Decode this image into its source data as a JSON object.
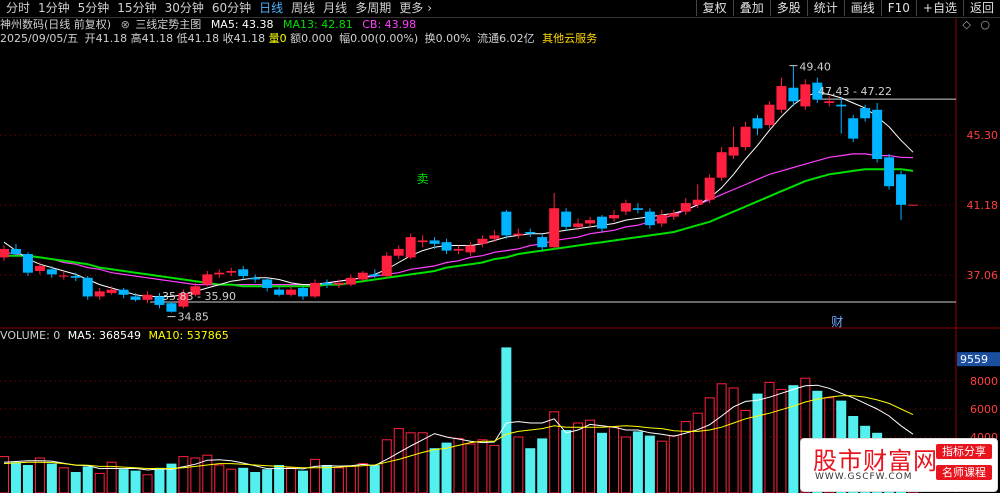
{
  "tabs": [
    {
      "label": "分时",
      "active": false
    },
    {
      "label": "1分钟",
      "active": false
    },
    {
      "label": "5分钟",
      "active": false
    },
    {
      "label": "15分钟",
      "active": false
    },
    {
      "label": "30分钟",
      "active": false
    },
    {
      "label": "60分钟",
      "active": false
    },
    {
      "label": "日线",
      "active": true
    },
    {
      "label": "周线",
      "active": false
    },
    {
      "label": "月线",
      "active": false
    },
    {
      "label": "多周期",
      "active": false
    },
    {
      "label": "更多",
      "active": false
    }
  ],
  "more_arrow": "›",
  "tools": [
    "复权",
    "叠加",
    "多股",
    "统计",
    "画线",
    "F10",
    "+自选",
    "返回"
  ],
  "legend": {
    "title": "神州数码(日线 前复权)",
    "indicator_marker": "⊗",
    "indicator_name": "三线定势主图",
    "ma5": "MA5: 43.38",
    "ma13": "MA13: 42.81",
    "cb": "CB: 43.98",
    "color_ma5": "#ffffff",
    "color_ma13": "#00e000",
    "color_cb": "#ff40ff"
  },
  "corner_icons": [
    "◇",
    "○"
  ],
  "info": {
    "date": "2025/09/05/五",
    "open": "开41.18",
    "high": "高41.18",
    "low": "低41.18",
    "close": "收41.18",
    "vol": "量0",
    "amount": "额0.000",
    "change": "幅0.00(0.00%)",
    "turnover": "换0.00%",
    "float": "流通6.02亿",
    "cloud": "其他云服务"
  },
  "volume_legend": {
    "vol": "VOLUME: 0",
    "ma5": "MA5: 368549",
    "ma10": "MA10: 537865"
  },
  "watermark": {
    "cn": "股市财富网",
    "url": "WWW.GSCFW.COM",
    "tag1": "指标分享",
    "tag2": "名师课程"
  },
  "chart_data": {
    "type": "candlestick",
    "price_axis": {
      "range": [
        34.0,
        50.5
      ],
      "ticks": [
        45.3,
        41.18,
        37.06
      ]
    },
    "volume_axis": {
      "range": [
        0,
        10500
      ],
      "ticks": [
        9559,
        8000,
        6000,
        4000
      ]
    },
    "annotations": {
      "high": "49.40",
      "high_range": "47.43 - 47.22",
      "low": "34.85",
      "low_range": "35.83 - 35.90",
      "sell_mark": "卖",
      "fin_mark": "财"
    },
    "reference_levels": [
      47.43,
      35.83
    ],
    "candles": [
      {
        "o": 38.1,
        "c": 38.6,
        "h": 38.8,
        "l": 37.9
      },
      {
        "o": 38.6,
        "c": 38.3,
        "h": 38.9,
        "l": 38.2
      },
      {
        "o": 38.3,
        "c": 37.2,
        "h": 38.4,
        "l": 37.0
      },
      {
        "o": 37.3,
        "c": 37.6,
        "h": 37.8,
        "l": 37.1
      },
      {
        "o": 37.4,
        "c": 37.1,
        "h": 37.6,
        "l": 36.9
      },
      {
        "o": 37.0,
        "c": 37.0,
        "h": 37.3,
        "l": 36.8
      },
      {
        "o": 37.0,
        "c": 36.9,
        "h": 37.2,
        "l": 36.7
      },
      {
        "o": 36.9,
        "c": 35.8,
        "h": 37.0,
        "l": 35.6
      },
      {
        "o": 35.8,
        "c": 36.1,
        "h": 36.3,
        "l": 35.6
      },
      {
        "o": 36.0,
        "c": 36.2,
        "h": 36.4,
        "l": 35.9
      },
      {
        "o": 36.2,
        "c": 35.9,
        "h": 36.3,
        "l": 35.7
      },
      {
        "o": 35.8,
        "c": 35.6,
        "h": 36.0,
        "l": 35.5
      },
      {
        "o": 35.6,
        "c": 35.9,
        "h": 36.1,
        "l": 35.4
      },
      {
        "o": 35.8,
        "c": 35.3,
        "h": 36.0,
        "l": 35.1
      },
      {
        "o": 35.4,
        "c": 34.9,
        "h": 35.5,
        "l": 34.85
      },
      {
        "o": 35.2,
        "c": 36.0,
        "h": 36.2,
        "l": 35.1
      },
      {
        "o": 35.9,
        "c": 36.4,
        "h": 36.6,
        "l": 35.8
      },
      {
        "o": 36.5,
        "c": 37.1,
        "h": 37.3,
        "l": 36.4
      },
      {
        "o": 37.1,
        "c": 37.2,
        "h": 37.4,
        "l": 36.9
      },
      {
        "o": 37.2,
        "c": 37.3,
        "h": 37.5,
        "l": 37.0
      },
      {
        "o": 37.4,
        "c": 37.0,
        "h": 37.6,
        "l": 36.8
      },
      {
        "o": 36.9,
        "c": 36.8,
        "h": 37.1,
        "l": 36.6
      },
      {
        "o": 36.8,
        "c": 36.3,
        "h": 36.9,
        "l": 36.1
      },
      {
        "o": 36.2,
        "c": 35.9,
        "h": 36.4,
        "l": 35.8
      },
      {
        "o": 35.9,
        "c": 36.2,
        "h": 36.4,
        "l": 35.8
      },
      {
        "o": 36.3,
        "c": 35.8,
        "h": 36.4,
        "l": 35.6
      },
      {
        "o": 35.8,
        "c": 36.6,
        "h": 36.8,
        "l": 35.7
      },
      {
        "o": 36.6,
        "c": 36.5,
        "h": 36.8,
        "l": 36.3
      },
      {
        "o": 36.5,
        "c": 36.6,
        "h": 36.8,
        "l": 36.3
      },
      {
        "o": 36.5,
        "c": 36.9,
        "h": 37.1,
        "l": 36.4
      },
      {
        "o": 36.8,
        "c": 37.2,
        "h": 37.3,
        "l": 36.7
      },
      {
        "o": 37.1,
        "c": 37.0,
        "h": 37.4,
        "l": 36.9
      },
      {
        "o": 37.0,
        "c": 38.2,
        "h": 38.4,
        "l": 36.9
      },
      {
        "o": 38.2,
        "c": 38.6,
        "h": 38.8,
        "l": 38.0
      },
      {
        "o": 38.1,
        "c": 39.3,
        "h": 39.5,
        "l": 38.0
      },
      {
        "o": 39.0,
        "c": 39.1,
        "h": 39.4,
        "l": 38.7
      },
      {
        "o": 39.1,
        "c": 38.9,
        "h": 39.3,
        "l": 38.6
      },
      {
        "o": 39.0,
        "c": 38.5,
        "h": 39.2,
        "l": 38.3
      },
      {
        "o": 38.5,
        "c": 38.6,
        "h": 38.8,
        "l": 38.3
      },
      {
        "o": 38.4,
        "c": 38.8,
        "h": 39.0,
        "l": 38.2
      },
      {
        "o": 38.9,
        "c": 39.2,
        "h": 39.4,
        "l": 38.7
      },
      {
        "o": 39.2,
        "c": 39.4,
        "h": 39.7,
        "l": 39.0
      },
      {
        "o": 40.8,
        "c": 39.4,
        "h": 40.9,
        "l": 39.2
      },
      {
        "o": 39.4,
        "c": 39.5,
        "h": 39.8,
        "l": 39.2
      },
      {
        "o": 39.6,
        "c": 39.5,
        "h": 39.8,
        "l": 39.3
      },
      {
        "o": 39.3,
        "c": 38.7,
        "h": 39.5,
        "l": 38.5
      },
      {
        "o": 38.7,
        "c": 41.0,
        "h": 41.9,
        "l": 38.6
      },
      {
        "o": 40.8,
        "c": 39.9,
        "h": 41.0,
        "l": 39.7
      },
      {
        "o": 39.9,
        "c": 40.1,
        "h": 40.4,
        "l": 39.7
      },
      {
        "o": 40.1,
        "c": 40.3,
        "h": 40.5,
        "l": 39.9
      },
      {
        "o": 40.5,
        "c": 39.8,
        "h": 40.6,
        "l": 39.6
      },
      {
        "o": 40.4,
        "c": 40.6,
        "h": 40.9,
        "l": 40.2
      },
      {
        "o": 40.8,
        "c": 41.3,
        "h": 41.5,
        "l": 40.6
      },
      {
        "o": 41.0,
        "c": 40.9,
        "h": 41.3,
        "l": 40.7
      },
      {
        "o": 40.8,
        "c": 40.0,
        "h": 41.0,
        "l": 39.8
      },
      {
        "o": 40.1,
        "c": 40.6,
        "h": 40.9,
        "l": 39.9
      },
      {
        "o": 40.5,
        "c": 40.7,
        "h": 40.9,
        "l": 40.3
      },
      {
        "o": 40.8,
        "c": 41.3,
        "h": 41.6,
        "l": 40.6
      },
      {
        "o": 41.2,
        "c": 41.5,
        "h": 42.4,
        "l": 41.0
      },
      {
        "o": 41.5,
        "c": 42.8,
        "h": 43.0,
        "l": 41.3
      },
      {
        "o": 42.8,
        "c": 44.3,
        "h": 44.6,
        "l": 42.6
      },
      {
        "o": 44.1,
        "c": 44.6,
        "h": 45.8,
        "l": 43.9
      },
      {
        "o": 44.6,
        "c": 45.8,
        "h": 46.1,
        "l": 44.4
      },
      {
        "o": 46.3,
        "c": 45.7,
        "h": 46.5,
        "l": 45.3
      },
      {
        "o": 45.9,
        "c": 47.1,
        "h": 47.3,
        "l": 45.7
      },
      {
        "o": 46.8,
        "c": 48.2,
        "h": 48.7,
        "l": 46.6
      },
      {
        "o": 48.1,
        "c": 47.3,
        "h": 49.4,
        "l": 47.0
      },
      {
        "o": 47.0,
        "c": 48.3,
        "h": 48.6,
        "l": 46.8
      },
      {
        "o": 48.4,
        "c": 47.4,
        "h": 48.7,
        "l": 47.2
      },
      {
        "o": 47.2,
        "c": 47.3,
        "h": 47.6,
        "l": 47.0
      },
      {
        "o": 47.1,
        "c": 47.0,
        "h": 47.5,
        "l": 45.4
      },
      {
        "o": 46.3,
        "c": 45.1,
        "h": 46.5,
        "l": 44.9
      },
      {
        "o": 46.9,
        "c": 46.3,
        "h": 47.1,
        "l": 46.1
      },
      {
        "o": 46.8,
        "c": 43.9,
        "h": 47.2,
        "l": 43.7
      },
      {
        "o": 44.0,
        "c": 42.3,
        "h": 44.2,
        "l": 42.1
      },
      {
        "o": 43.0,
        "c": 41.2,
        "h": 43.2,
        "l": 40.3
      },
      {
        "o": 41.18,
        "c": 41.18,
        "h": 41.18,
        "l": 41.18
      }
    ],
    "ma5_line": [
      39.0,
      38.5,
      38.0,
      37.7,
      37.5,
      37.3,
      37.1,
      36.8,
      36.5,
      36.3,
      36.1,
      35.9,
      35.8,
      35.8,
      35.8,
      35.9,
      36.1,
      36.3,
      36.5,
      36.7,
      36.8,
      36.9,
      36.9,
      36.8,
      36.6,
      36.5,
      36.5,
      36.6,
      36.7,
      36.8,
      36.9,
      37.1,
      37.4,
      37.8,
      38.2,
      38.5,
      38.7,
      38.8,
      38.8,
      38.8,
      38.9,
      39.1,
      39.3,
      39.4,
      39.5,
      39.5,
      39.6,
      39.7,
      39.8,
      39.9,
      40.0,
      40.1,
      40.3,
      40.4,
      40.5,
      40.6,
      40.7,
      40.9,
      41.2,
      41.6,
      42.2,
      43.0,
      43.9,
      44.7,
      45.6,
      46.4,
      47.1,
      47.6,
      47.8,
      47.7,
      47.5,
      47.2,
      46.9,
      46.4,
      45.8,
      45.0,
      44.3
    ],
    "ma13_line": [
      38.2,
      38.2,
      38.2,
      38.1,
      38.0,
      37.9,
      37.8,
      37.7,
      37.5,
      37.4,
      37.3,
      37.2,
      37.1,
      37.0,
      36.9,
      36.8,
      36.7,
      36.6,
      36.5,
      36.5,
      36.4,
      36.4,
      36.4,
      36.4,
      36.4,
      36.4,
      36.4,
      36.5,
      36.5,
      36.6,
      36.7,
      36.8,
      36.9,
      37.0,
      37.1,
      37.2,
      37.3,
      37.5,
      37.6,
      37.7,
      37.8,
      38.0,
      38.1,
      38.3,
      38.4,
      38.5,
      38.6,
      38.7,
      38.8,
      38.9,
      39.0,
      39.1,
      39.2,
      39.3,
      39.4,
      39.5,
      39.6,
      39.8,
      40.0,
      40.2,
      40.5,
      40.8,
      41.1,
      41.4,
      41.7,
      42.0,
      42.3,
      42.6,
      42.8,
      43.0,
      43.1,
      43.2,
      43.3,
      43.3,
      43.3,
      43.3,
      43.2
    ],
    "cb_line": [
      38.4,
      38.3,
      38.2,
      38.1,
      38.0,
      37.8,
      37.7,
      37.5,
      37.4,
      37.2,
      37.1,
      37.0,
      36.9,
      36.8,
      36.7,
      36.6,
      36.5,
      36.5,
      36.5,
      36.5,
      36.5,
      36.5,
      36.5,
      36.5,
      36.5,
      36.5,
      36.5,
      36.6,
      36.7,
      36.8,
      36.9,
      37.0,
      37.1,
      37.2,
      37.4,
      37.5,
      37.6,
      37.8,
      37.9,
      38.1,
      38.2,
      38.4,
      38.5,
      38.6,
      38.8,
      38.9,
      39.1,
      39.2,
      39.3,
      39.5,
      39.6,
      39.7,
      39.9,
      40.0,
      40.2,
      40.4,
      40.6,
      40.9,
      41.2,
      41.5,
      41.8,
      42.1,
      42.4,
      42.7,
      43.0,
      43.2,
      43.4,
      43.6,
      43.8,
      44.0,
      44.1,
      44.2,
      44.2,
      44.1,
      44.1,
      44.0,
      43.98
    ],
    "volumes": [
      2600,
      2200,
      2000,
      2500,
      2100,
      1800,
      1500,
      1900,
      1400,
      2200,
      1700,
      1600,
      1300,
      1800,
      2100,
      2600,
      2500,
      2700,
      2000,
      1700,
      1800,
      1500,
      1700,
      2000,
      1800,
      1600,
      2400,
      2000,
      1800,
      1900,
      2100,
      2000,
      3800,
      4600,
      4300,
      4300,
      3200,
      3600,
      3900,
      3500,
      3800,
      3400,
      10400,
      4000,
      3200,
      3900,
      5800,
      4500,
      5000,
      5200,
      4300,
      4700,
      4000,
      4400,
      4100,
      3700,
      4100,
      5100,
      5700,
      6800,
      7800,
      7500,
      5900,
      7100,
      7900,
      7400,
      7700,
      8200,
      7300,
      6800,
      6600,
      5500,
      4800,
      4300,
      3500,
      2800,
      2200
    ],
    "vol_ma5": [
      2200,
      2250,
      2300,
      2300,
      2280,
      2120,
      1980,
      1960,
      1740,
      1760,
      1740,
      1760,
      1640,
      1720,
      1700,
      1880,
      2060,
      2340,
      2380,
      2300,
      2140,
      1940,
      1740,
      1740,
      1760,
      1720,
      1900,
      1960,
      1920,
      1940,
      2040,
      1960,
      2400,
      2880,
      3360,
      3800,
      4240,
      4000,
      3860,
      3700,
      3600,
      3640,
      5000,
      5100,
      5000,
      5000,
      5300,
      4300,
      4500,
      4900,
      4800,
      4700,
      4500,
      4500,
      4300,
      4200,
      4060,
      4280,
      4520,
      4880,
      5500,
      6160,
      6540,
      6620,
      6840,
      7120,
      7400,
      7660,
      7700,
      7480,
      7120,
      6800,
      6400,
      6000,
      5500,
      4800,
      4200
    ],
    "vol_ma10": [
      2100,
      2150,
      2200,
      2200,
      2180,
      2100,
      2000,
      1980,
      1900,
      1900,
      1850,
      1800,
      1750,
      1750,
      1750,
      1800,
      1900,
      2000,
      2100,
      2100,
      2050,
      2000,
      1950,
      1900,
      1850,
      1800,
      1800,
      1800,
      1850,
      1900,
      1950,
      2000,
      2200,
      2400,
      2650,
      2900,
      3100,
      3200,
      3400,
      3600,
      3700,
      3700,
      4200,
      4400,
      4500,
      4600,
      4800,
      4700,
      4700,
      4700,
      4700,
      4750,
      4800,
      4750,
      4650,
      4600,
      4450,
      4400,
      4400,
      4500,
      4700,
      5000,
      5300,
      5500,
      5700,
      5950,
      6200,
      6500,
      6700,
      6850,
      6950,
      6950,
      6850,
      6650,
      6400,
      6000,
      5600
    ]
  }
}
